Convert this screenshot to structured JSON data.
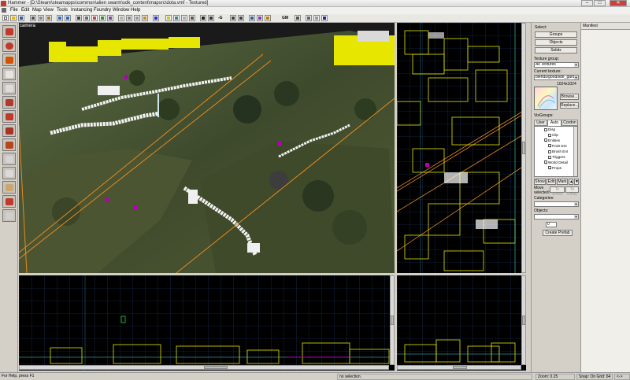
{
  "window": {
    "title": "Hammer - [D:\\Steam\\steamapps\\common\\alien swarm\\sdk_content\\mapsrc\\dota.vmf - Textured]",
    "min_label": "–",
    "max_label": "□",
    "close_label": "✕"
  },
  "menu": [
    "File",
    "Edit",
    "Map",
    "View",
    "Tools",
    "Instancing",
    "Foundry",
    "Window",
    "Help"
  ],
  "toolbar": {
    "grid_label": "-G",
    "group_label": "GM",
    "icons": [
      "new-icon",
      "open-icon",
      "save-icon",
      "cut-icon",
      "copy-icon",
      "paste-icon",
      "undo-icon",
      "redo-icon",
      "camera-icon",
      "grid-icon",
      "texture-lock-icon",
      "snap-icon",
      "3d-grid-icon",
      "hide-icon",
      "group-icon",
      "ungroup-icon",
      "carve-icon",
      "run-map-icon"
    ]
  },
  "tools": [
    "selection-tool",
    "magnify-tool",
    "camera-tool",
    "entity-tool",
    "block-tool",
    "texture-tool",
    "apply-texture-tool",
    "decal-tool",
    "overlay-tool",
    "clipping-tool",
    "vertex-tool",
    "path-tool",
    "sprinkle-tool",
    "blank-tool"
  ],
  "viewports": {
    "camera_label": "camera"
  },
  "panel": {
    "select_label": "Select:",
    "groups_btn": "Groups",
    "objects_btn": "Objects",
    "solids_btn": "Solids",
    "texture_group_label": "Texture group:",
    "texture_group_value": "All Textures",
    "current_texture_label": "Current texture:",
    "current_texture_value": "blends/goodoide_garde",
    "texture_size": "1024x1024",
    "browse_btn": "Browse...",
    "replace_btn": "Replace...",
    "visgroups_label": "VisGroups:",
    "tabs": [
      "User",
      "Auto",
      "Cordon"
    ],
    "visgroup_items": [
      {
        "label": "Disp",
        "checked": false,
        "indent": 1
      },
      {
        "label": "Clip",
        "checked": false,
        "indent": 2
      },
      {
        "label": "Entities",
        "checked": true,
        "indent": 1
      },
      {
        "label": "Point Ent",
        "checked": true,
        "indent": 2
      },
      {
        "label": "Brush Ent",
        "checked": false,
        "indent": 2
      },
      {
        "label": "Triggers",
        "checked": false,
        "indent": 2
      },
      {
        "label": "World Detail",
        "checked": true,
        "indent": 1
      },
      {
        "label": "Props",
        "checked": true,
        "indent": 2
      }
    ],
    "show_btn": "Show",
    "edit_btn": "Edit",
    "mark_btn": "Mark",
    "move_selected_label": "Move selected:",
    "to_world_btn": "To World",
    "to_entity_btn": "To Entity",
    "categories_label": "Categories:",
    "objects_label": "Objects:",
    "objects_count": "0",
    "create_prefab_btn": "Create Prefab"
  },
  "manifest": {
    "title": "Manifest"
  },
  "statusbar": {
    "help": "For Help, press F1",
    "selection": "no selection.",
    "zoom": "Zoom: 0.25",
    "snap": "Snap: On Grid: 64",
    "coords": "<->"
  },
  "colors": {
    "grid": "#1e3f72",
    "brush_yellow": "#e6e600",
    "viewport_bg": "#000000"
  }
}
